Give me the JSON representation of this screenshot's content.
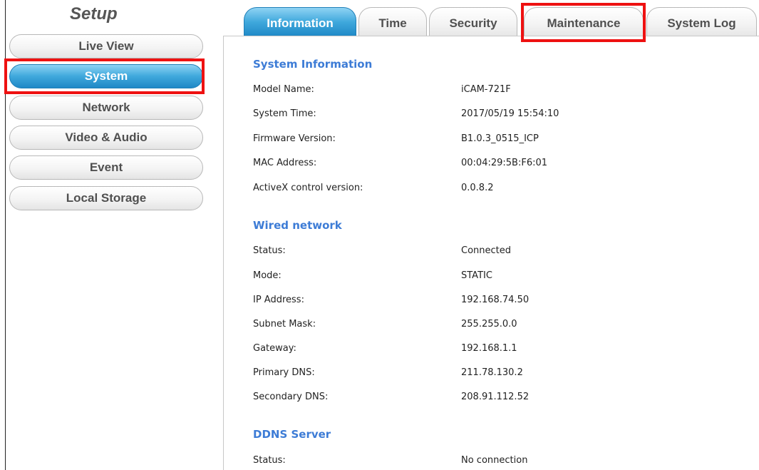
{
  "sidebar": {
    "title": "Setup",
    "items": [
      {
        "label": "Live View",
        "active": false
      },
      {
        "label": "System",
        "active": true
      },
      {
        "label": "Network",
        "active": false
      },
      {
        "label": "Video & Audio",
        "active": false
      },
      {
        "label": "Event",
        "active": false
      },
      {
        "label": "Local Storage",
        "active": false
      }
    ]
  },
  "tabs": [
    {
      "label": "Information",
      "active": true
    },
    {
      "label": "Time",
      "active": false
    },
    {
      "label": "Security",
      "active": false
    },
    {
      "label": "Maintenance",
      "active": false
    },
    {
      "label": "System Log",
      "active": false
    }
  ],
  "sections": {
    "system_info": {
      "title": "System Information",
      "rows": [
        {
          "label": "Model Name:",
          "value": "iCAM-721F"
        },
        {
          "label": "System Time:",
          "value": "2017/05/19 15:54:10"
        },
        {
          "label": "Firmware Version:",
          "value": "B1.0.3_0515_ICP"
        },
        {
          "label": "MAC Address:",
          "value": "00:04:29:5B:F6:01"
        },
        {
          "label": "ActiveX control version:",
          "value": "0.0.8.2"
        }
      ]
    },
    "wired_network": {
      "title": "Wired network",
      "rows": [
        {
          "label": "Status:",
          "value": "Connected"
        },
        {
          "label": "Mode:",
          "value": "STATIC"
        },
        {
          "label": "IP Address:",
          "value": "192.168.74.50"
        },
        {
          "label": "Subnet Mask:",
          "value": "255.255.0.0"
        },
        {
          "label": "Gateway:",
          "value": "192.168.1.1"
        },
        {
          "label": "Primary DNS:",
          "value": "211.78.130.2"
        },
        {
          "label": "Secondary DNS:",
          "value": "208.91.112.52"
        }
      ]
    },
    "ddns_server": {
      "title": "DDNS Server",
      "rows": [
        {
          "label": "Status:",
          "value": "No connection"
        }
      ]
    }
  },
  "colors": {
    "accent_blue": "#3fa8dc",
    "section_title": "#3d7cd6",
    "highlight_red": "#ee1111"
  }
}
